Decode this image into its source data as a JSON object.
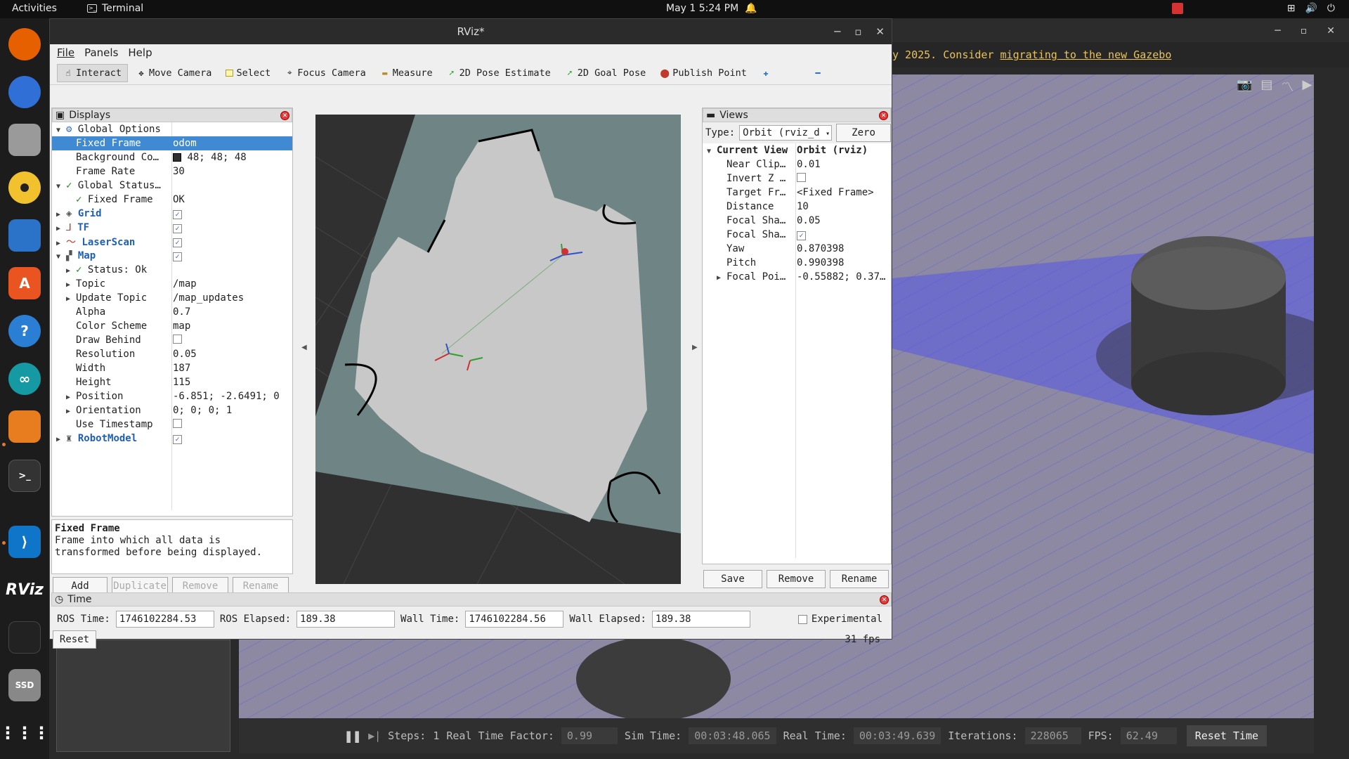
{
  "topbar": {
    "activities": "Activities",
    "app_name": "Terminal",
    "clock": "May 1   5:24 PM"
  },
  "gazebo": {
    "banner_text": "y 2025. Consider",
    "banner_link": "migrating to the new Gazebo",
    "status": {
      "steps_label": "Steps:",
      "steps_value": "1",
      "rtf_label": "Real Time Factor:",
      "rtf_value": "0.99",
      "sim_label": "Sim Time:",
      "sim_value": "00:03:48.065",
      "real_label": "Real Time:",
      "real_value": "00:03:49.639",
      "iter_label": "Iterations:",
      "iter_value": "228065",
      "fps_label": "FPS:",
      "fps_value": "62.49",
      "reset_time": "Reset Time"
    }
  },
  "rviz": {
    "title": "RViz*",
    "menu": [
      "File",
      "Panels",
      "Help"
    ],
    "tools": [
      {
        "label": "Interact",
        "icon": "hand-icon"
      },
      {
        "label": "Move Camera",
        "icon": "move-camera-icon"
      },
      {
        "label": "Select",
        "icon": "select-icon"
      },
      {
        "label": "Focus Camera",
        "icon": "focus-icon"
      },
      {
        "label": "Measure",
        "icon": "ruler-icon"
      },
      {
        "label": "2D Pose Estimate",
        "icon": "pose-arrow-icon"
      },
      {
        "label": "2D Goal Pose",
        "icon": "goal-arrow-icon"
      },
      {
        "label": "Publish Point",
        "icon": "pin-icon"
      }
    ],
    "displays": {
      "title": "Displays",
      "rows": [
        {
          "k": "Global Options",
          "v": ""
        },
        {
          "k": "Fixed Frame",
          "v": "odom"
        },
        {
          "k": "Background Co…",
          "v": "48; 48; 48"
        },
        {
          "k": "Frame Rate",
          "v": "30"
        },
        {
          "k": "Global Status…",
          "v": ""
        },
        {
          "k": "Fixed Frame",
          "v": "OK"
        },
        {
          "k": "Grid",
          "v": ""
        },
        {
          "k": "TF",
          "v": ""
        },
        {
          "k": "LaserScan",
          "v": ""
        },
        {
          "k": "Map",
          "v": ""
        },
        {
          "k": "Status: Ok",
          "v": ""
        },
        {
          "k": "Topic",
          "v": "/map"
        },
        {
          "k": "Update Topic",
          "v": "/map_updates"
        },
        {
          "k": "Alpha",
          "v": "0.7"
        },
        {
          "k": "Color Scheme",
          "v": "map"
        },
        {
          "k": "Draw Behind",
          "v": ""
        },
        {
          "k": "Resolution",
          "v": "0.05"
        },
        {
          "k": "Width",
          "v": "187"
        },
        {
          "k": "Height",
          "v": "115"
        },
        {
          "k": "Position",
          "v": "-6.851; -2.6491; 0"
        },
        {
          "k": "Orientation",
          "v": "0; 0; 0; 1"
        },
        {
          "k": "Use Timestamp",
          "v": ""
        },
        {
          "k": "RobotModel",
          "v": ""
        }
      ],
      "desc_title": "Fixed Frame",
      "desc_body1": "Frame into which all data is",
      "desc_body2": "transformed before being displayed.",
      "buttons": [
        "Add",
        "Duplicate",
        "Remove",
        "Rename"
      ]
    },
    "views": {
      "title": "Views",
      "type_label": "Type:",
      "type_value": "Orbit (rviz_d",
      "zero": "Zero",
      "rows": [
        {
          "k": "Current View",
          "v": "Orbit (rviz)"
        },
        {
          "k": "Near Clip…",
          "v": "0.01"
        },
        {
          "k": "Invert Z …",
          "v": ""
        },
        {
          "k": "Target Fr…",
          "v": "<Fixed Frame>"
        },
        {
          "k": "Distance",
          "v": "10"
        },
        {
          "k": "Focal Sha…",
          "v": "0.05"
        },
        {
          "k": "Focal Sha…",
          "v": ""
        },
        {
          "k": "Yaw",
          "v": "0.870398"
        },
        {
          "k": "Pitch",
          "v": "0.990398"
        },
        {
          "k": "Focal Poi…",
          "v": "-0.55882; 0.37…"
        }
      ],
      "buttons": [
        "Save",
        "Remove",
        "Rename"
      ]
    },
    "time": {
      "title": "Time",
      "ros_time_label": "ROS Time:",
      "ros_time": "1746102284.53",
      "ros_elapsed_label": "ROS Elapsed:",
      "ros_elapsed": "189.38",
      "wall_time_label": "Wall Time:",
      "wall_time": "1746102284.56",
      "wall_elapsed_label": "Wall Elapsed:",
      "wall_elapsed": "189.38",
      "experimental": "Experimental",
      "reset": "Reset",
      "fps": "31 fps"
    }
  },
  "colors": {
    "selection": "#3f8ad3",
    "map_free": "#c8c8c8",
    "map_unknown": "#6f8585",
    "viewport_bg": "#303030"
  }
}
